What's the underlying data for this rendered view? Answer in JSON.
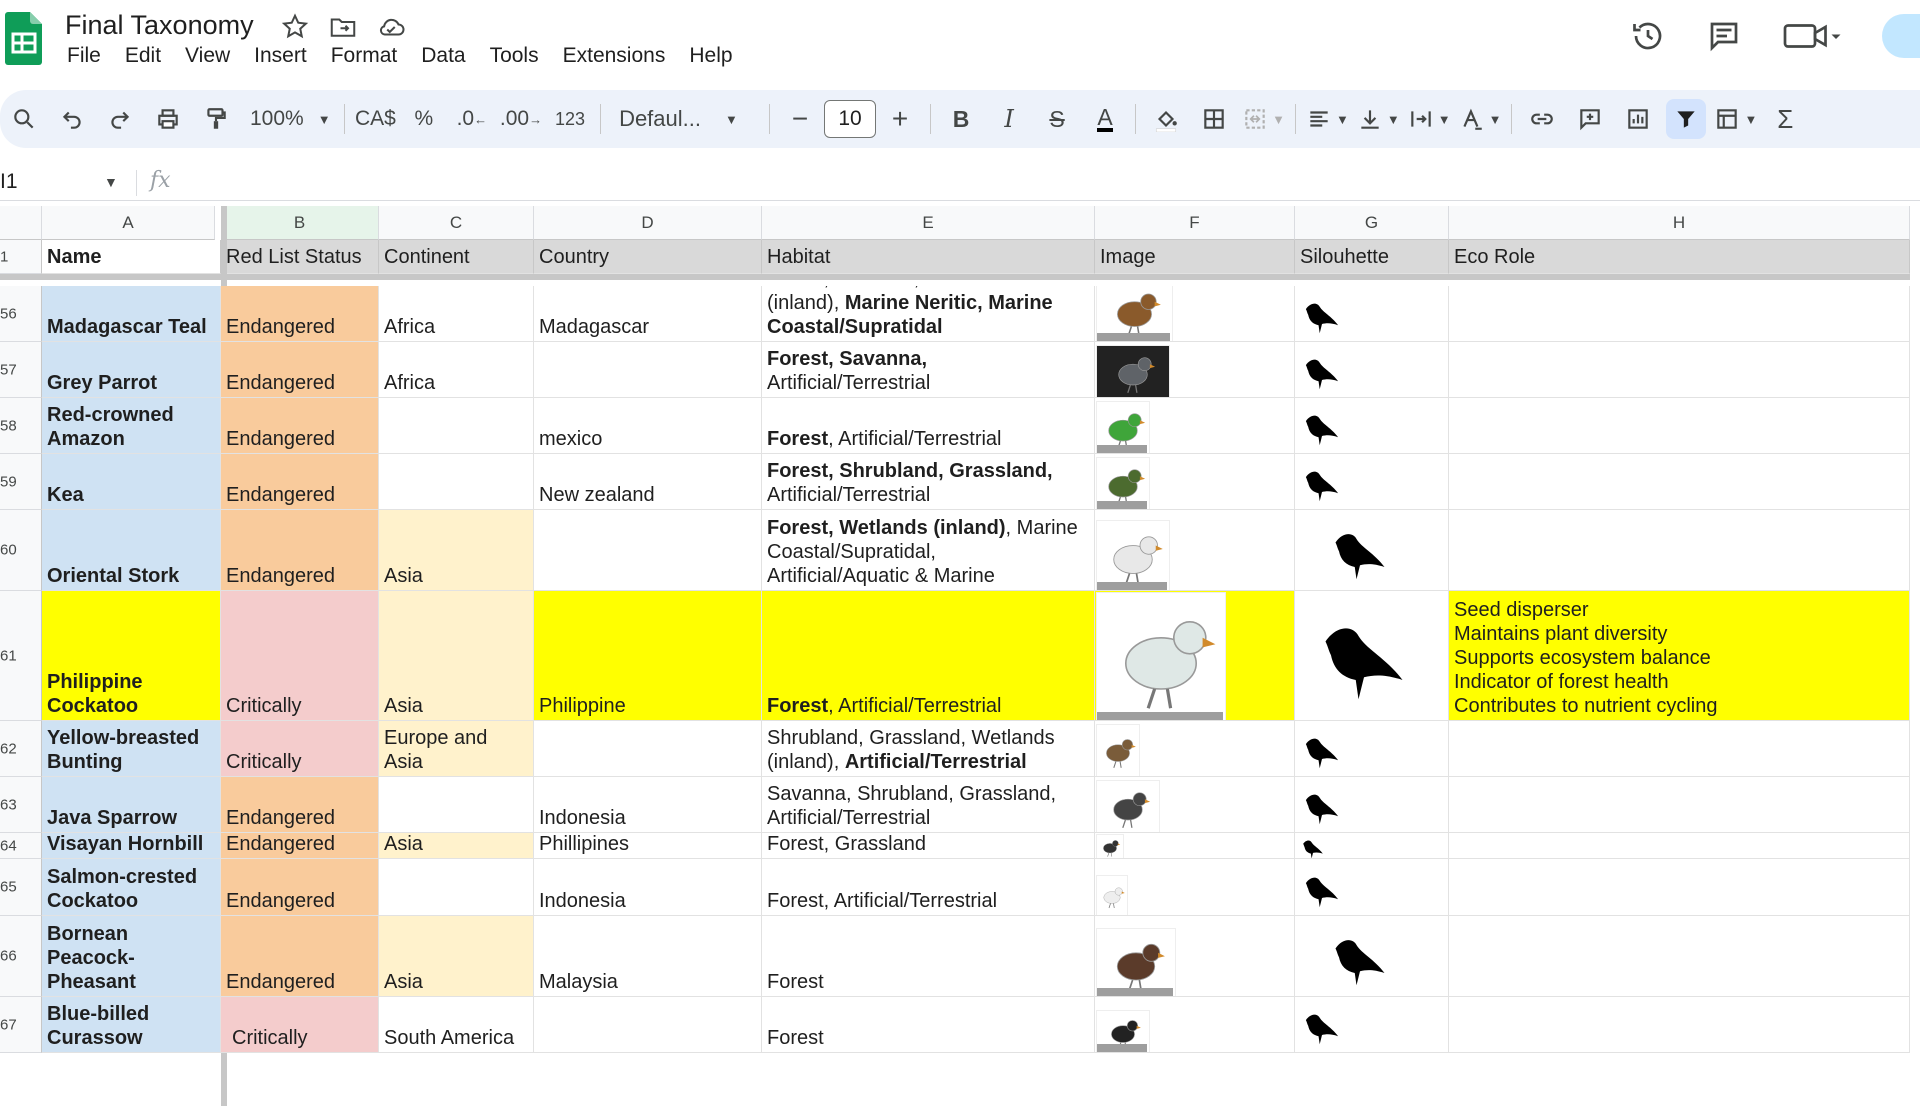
{
  "title": "Final Taxonomy",
  "menu": [
    "File",
    "Edit",
    "View",
    "Insert",
    "Format",
    "Data",
    "Tools",
    "Extensions",
    "Help"
  ],
  "toolbar": {
    "zoom": "100%",
    "currency": "CA$",
    "percent": "%",
    "dec_decrease": ".0",
    "dec_increase": ".00",
    "number_format": "123",
    "font": "Defaul...",
    "font_size": "10"
  },
  "formula_bar": {
    "name_box": "I1",
    "fx": "fx"
  },
  "columns": [
    "A",
    "B",
    "C",
    "D",
    "E",
    "F",
    "G",
    "H"
  ],
  "header_row": {
    "row_number": "1",
    "cells": [
      "Name",
      "Red List Status",
      "Continent",
      "Country",
      "Habitat",
      "Image",
      "Silouhette",
      "Eco Role"
    ]
  },
  "rows": [
    {
      "num": "56",
      "name": "Madagascar Teal",
      "status": "Endangered",
      "continent": "Africa",
      "country": "Madagascar",
      "habitat": [
        [
          "Forest, Savanna, Wetlands",
          false
        ],
        [
          "(inland), ",
          false
        ],
        [
          "Marine Neritic, Marine",
          true
        ],
        [
          "Coastal/Supratidal",
          true
        ]
      ],
      "eco": []
    },
    {
      "num": "57",
      "name": "Grey Parrot",
      "status": "Endangered",
      "continent": "Africa",
      "country": "",
      "habitat": [
        [
          "Forest, Savanna,",
          true
        ],
        [
          "Artificial/Terrestrial",
          false
        ]
      ],
      "eco": []
    },
    {
      "num": "58",
      "name": "Red-crowned Amazon",
      "status": "Endangered",
      "continent": "",
      "country": "mexico",
      "habitat": [
        [
          "Forest",
          true
        ],
        [
          ", Artificial/Terrestrial",
          false
        ]
      ],
      "eco": []
    },
    {
      "num": "59",
      "name": "Kea",
      "status": "Endangered",
      "continent": "",
      "country": "New zealand",
      "habitat": [
        [
          "Forest, Shrubland, Grassland,",
          true
        ],
        [
          "Artificial/Terrestrial",
          false
        ]
      ],
      "eco": []
    },
    {
      "num": "60",
      "name": "Oriental Stork",
      "status": "Endangered",
      "continent": "Asia",
      "country": "",
      "habitat": [
        [
          "Forest, Wetlands (inland)",
          true
        ],
        [
          ", Marine",
          false
        ],
        [
          "Coastal/Supratidal,",
          false
        ],
        [
          "Artificial/Aquatic & Marine",
          false
        ]
      ],
      "eco": []
    },
    {
      "num": "61",
      "name": "Philippine Cockatoo",
      "status": "Critically",
      "continent": "Asia",
      "country": "Philippine",
      "habitat": [
        [
          "Forest",
          true
        ],
        [
          ", Artificial/Terrestrial",
          false
        ]
      ],
      "eco": [
        "Seed disperser",
        "Maintains plant diversity",
        "Supports ecosystem balance",
        "Indicator of forest health",
        "Contributes to nutrient cycling"
      ]
    },
    {
      "num": "62",
      "name": "Yellow-breasted Bunting",
      "status": "Critically",
      "continent": "Europe and Asia",
      "country": "",
      "habitat": [
        [
          "Shrubland, Grassland, Wetlands",
          false
        ],
        [
          "(inland), ",
          false
        ],
        [
          "Artificial/Terrestrial",
          true
        ]
      ],
      "eco": []
    },
    {
      "num": "63",
      "name": "Java Sparrow",
      "status": "Endangered",
      "continent": "",
      "country": "Indonesia",
      "habitat": [
        [
          "Savanna, Shrubland, Grassland,",
          false
        ],
        [
          "Artificial/Terrestrial",
          false
        ]
      ],
      "eco": []
    },
    {
      "num": "64",
      "name": "Visayan Hornbill",
      "status": "Endangered",
      "continent": "Asia",
      "country": "Phillipines",
      "habitat": [
        [
          "Forest, Grassland",
          false
        ]
      ],
      "eco": []
    },
    {
      "num": "65",
      "name": "Salmon-crested Cockatoo",
      "status": "Endangered",
      "continent": "",
      "country": "Indonesia",
      "habitat": [
        [
          "Forest, Artificial/Terrestrial",
          false
        ]
      ],
      "eco": []
    },
    {
      "num": "66",
      "name": "Bornean Peacock-Pheasant",
      "status": "Endangered",
      "continent": "Asia",
      "country": "Malaysia",
      "habitat": [
        [
          "Forest",
          false
        ]
      ],
      "eco": []
    },
    {
      "num": "67",
      "name": "Blue-billed Curassow",
      "status": "Critically",
      "continent": "South America",
      "country": "",
      "habitat": [
        [
          "Forest",
          false
        ]
      ],
      "eco": []
    }
  ],
  "colors": {
    "name_col": "#cfe2f3",
    "endangered": "#f9cb9c",
    "critically": "#f4cccc",
    "asia": "#fff2cc",
    "highlight": "#ffff00",
    "header": "#d9d9d9",
    "sheets_green": "#0f9d58"
  }
}
